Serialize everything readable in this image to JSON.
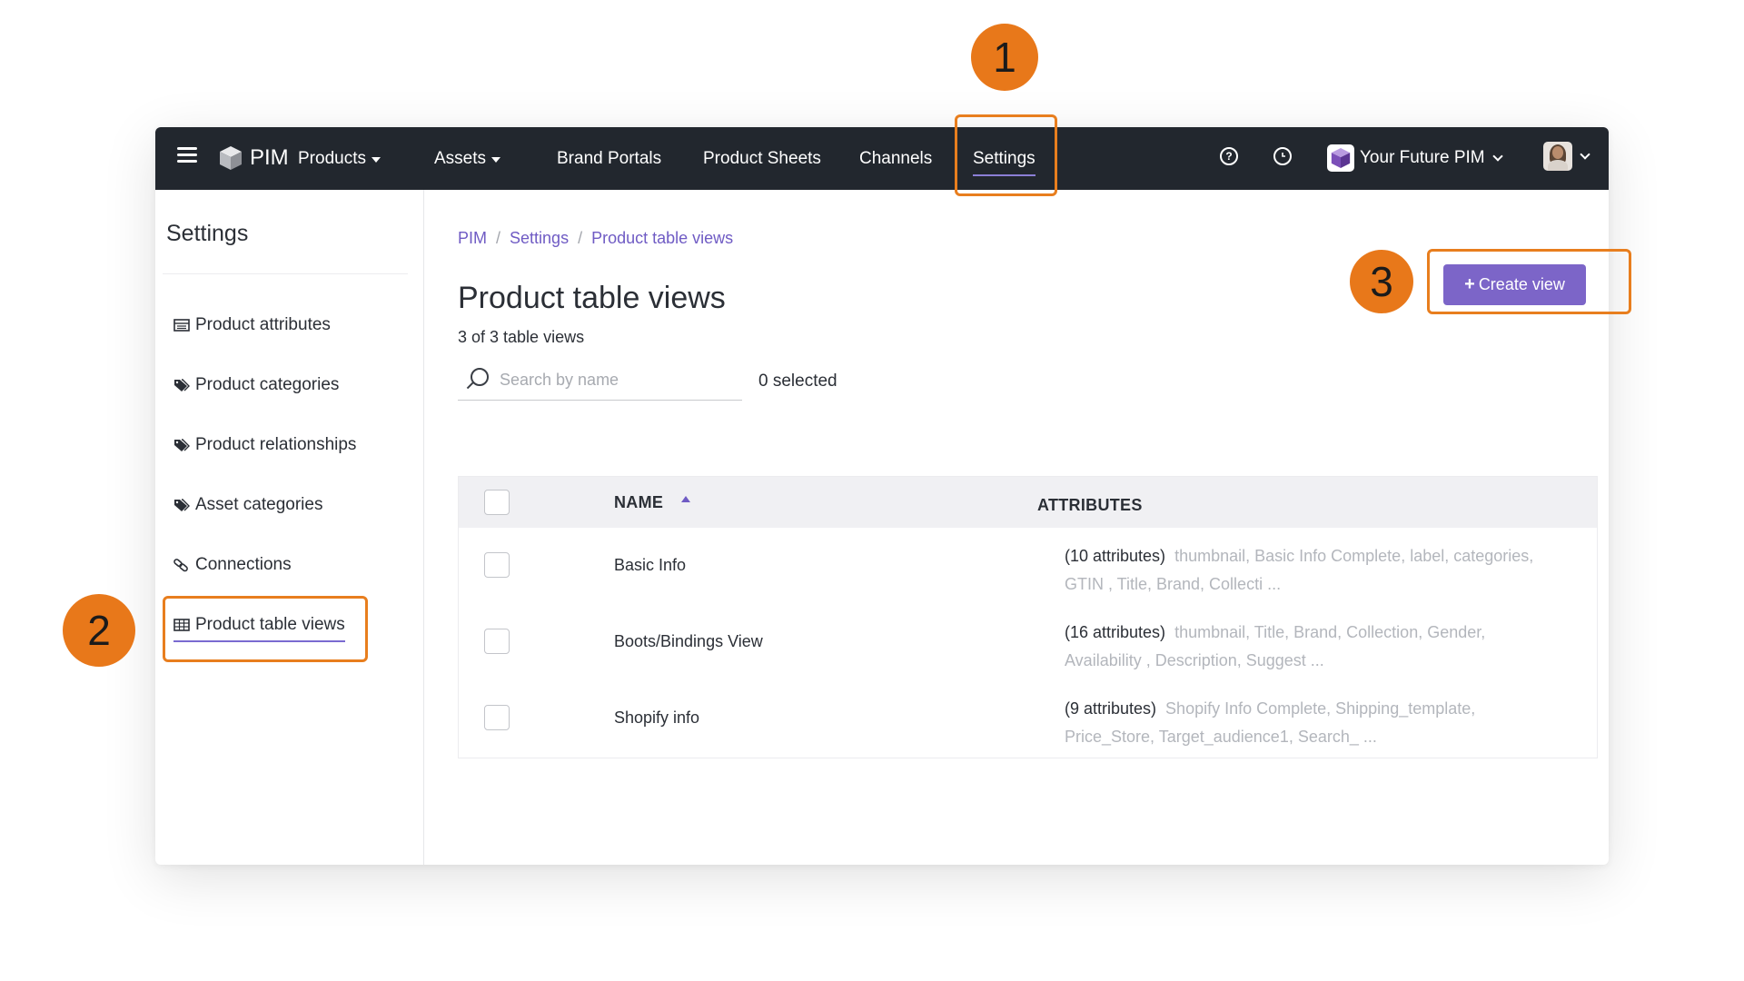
{
  "topnav": {
    "brand": "PIM",
    "items": [
      {
        "label": "Products",
        "dropdown": true
      },
      {
        "label": "Assets",
        "dropdown": true
      },
      {
        "label": "Brand Portals",
        "dropdown": false
      },
      {
        "label": "Product Sheets",
        "dropdown": false
      },
      {
        "label": "Channels",
        "dropdown": false
      },
      {
        "label": "Settings",
        "dropdown": false,
        "active": true
      }
    ],
    "help_icon": "question-circle-icon",
    "history_icon": "clock-icon",
    "workspace": "Your Future PIM",
    "accent_color": "#8b7fd6",
    "bg_color": "#22272e"
  },
  "sidebar": {
    "title": "Settings",
    "items": [
      {
        "label": "Product attributes",
        "icon": "table-list-icon"
      },
      {
        "label": "Product categories",
        "icon": "tags-icon"
      },
      {
        "label": "Product relationships",
        "icon": "tags-icon"
      },
      {
        "label": "Asset categories",
        "icon": "tags-icon"
      },
      {
        "label": "Connections",
        "icon": "link-icon"
      },
      {
        "label": "Product table views",
        "icon": "table-icon",
        "active": true
      }
    ]
  },
  "breadcrumb": [
    "PIM",
    "Settings",
    "Product table views"
  ],
  "page": {
    "title": "Product table views",
    "count_text": "3 of 3 table views",
    "search_placeholder": "Search by name",
    "selected_text": "0 selected",
    "create_button": "Create view",
    "create_color": "#7c65c8"
  },
  "table": {
    "columns": [
      "NAME",
      "ATTRIBUTES"
    ],
    "sort": "NAME ascending",
    "rows": [
      {
        "name": "Basic Info",
        "count": "(10 attributes)",
        "attrs": "thumbnail, Basic Info Complete, label, categories, GTIN , Title, Brand, Collecti ..."
      },
      {
        "name": "Boots/Bindings View",
        "count": "(16 attributes)",
        "attrs": "thumbnail, Title, Brand, Collection, Gender, Availability , Description, Suggest ..."
      },
      {
        "name": "Shopify info",
        "count": "(9 attributes)",
        "attrs": "Shopify Info Complete, Shipping_template, Price_Store, Target_audience1, Search_ ..."
      }
    ]
  },
  "callouts": {
    "badge1": "1",
    "badge2": "2",
    "badge3": "3",
    "color": "#e8781a"
  }
}
